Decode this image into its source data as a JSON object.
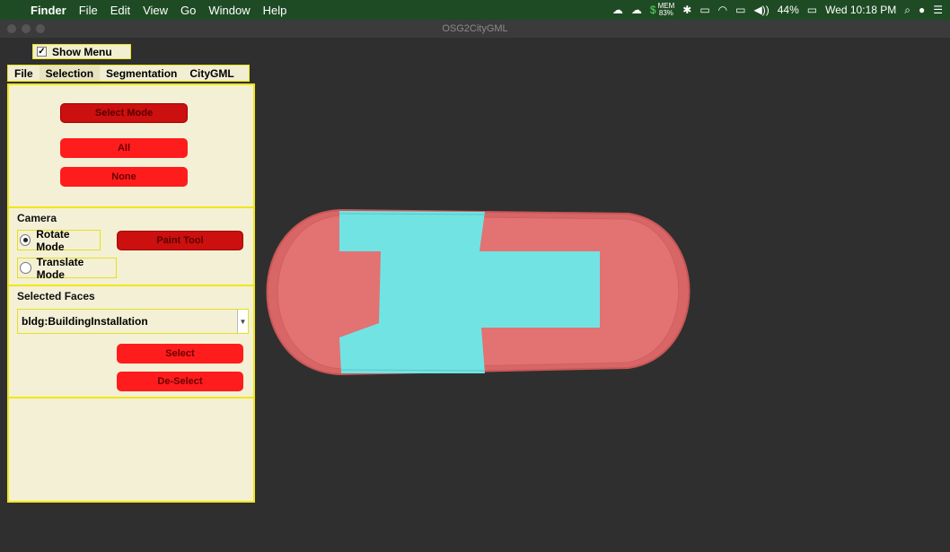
{
  "menubar": {
    "app": "Finder",
    "menus": [
      "File",
      "Edit",
      "View",
      "Go",
      "Window",
      "Help"
    ],
    "mem_label": "MEM",
    "mem_value": "83%",
    "battery": "44%",
    "clock": "Wed 10:18 PM"
  },
  "window": {
    "title": "OSG2CityGML"
  },
  "panel": {
    "show_menu": "Show Menu",
    "tabs": [
      "File",
      "Selection",
      "Segmentation",
      "CityGML"
    ],
    "select_mode": "Select Mode",
    "all": "All",
    "none": "None",
    "camera_label": "Camera",
    "rotate_mode": "Rotate Mode",
    "translate_mode": "Translate Mode",
    "paint_tool": "Paint Tool",
    "selected_faces_label": "Selected Faces",
    "dropdown_value": "bldg:BuildingInstallation",
    "select": "Select",
    "deselect": "De-Select"
  },
  "colors": {
    "menubar_bg": "#1e4b24",
    "panel_bg": "#f4f0d6",
    "panel_border": "#f0e714",
    "button_dark": "#cc0f0f",
    "button_bright": "#ff1c1c",
    "mesh_red": "#e16e6e",
    "mesh_cyan": "#72e3e3"
  }
}
